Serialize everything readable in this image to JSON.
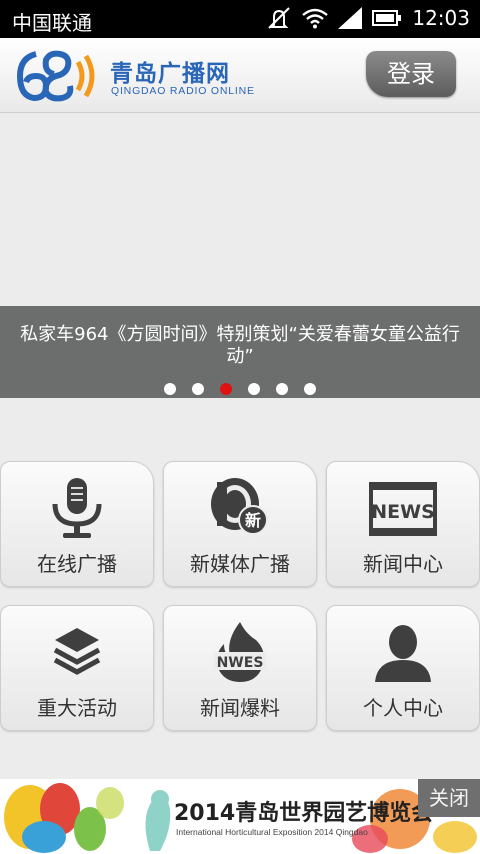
{
  "status_bar": {
    "carrier": "中国联通",
    "time": "12:03"
  },
  "header": {
    "logo_cn": "青岛广播网",
    "logo_en": "QINGDAO RADIO ONLINE",
    "login_label": "登录"
  },
  "banner": {
    "caption": "私家车964《方圆时间》特别策划“关爱春蕾女童公益行动”",
    "slide_count": 6,
    "active_slide": 3
  },
  "menu": {
    "items": [
      {
        "label": "在线广播",
        "icon": "microphone-icon"
      },
      {
        "label": "新媒体广播",
        "icon": "new-media-icon"
      },
      {
        "label": "新闻中心",
        "icon": "news-icon"
      },
      {
        "label": "重大活动",
        "icon": "layers-icon"
      },
      {
        "label": "新闻爆料",
        "icon": "flame-icon"
      },
      {
        "label": "个人中心",
        "icon": "person-icon"
      }
    ],
    "new_badge": "新",
    "news_word": "NEWS",
    "flame_word": "NWES"
  },
  "ad": {
    "title": "2014青岛世界园艺博览会",
    "subtitle": "International Horticultural Exposition 2014 Qingdao",
    "close_label": "关闭"
  },
  "colors": {
    "brand_blue": "#2a66b8",
    "logo_orange": "#f39a1d",
    "active_dot": "#e01111"
  }
}
